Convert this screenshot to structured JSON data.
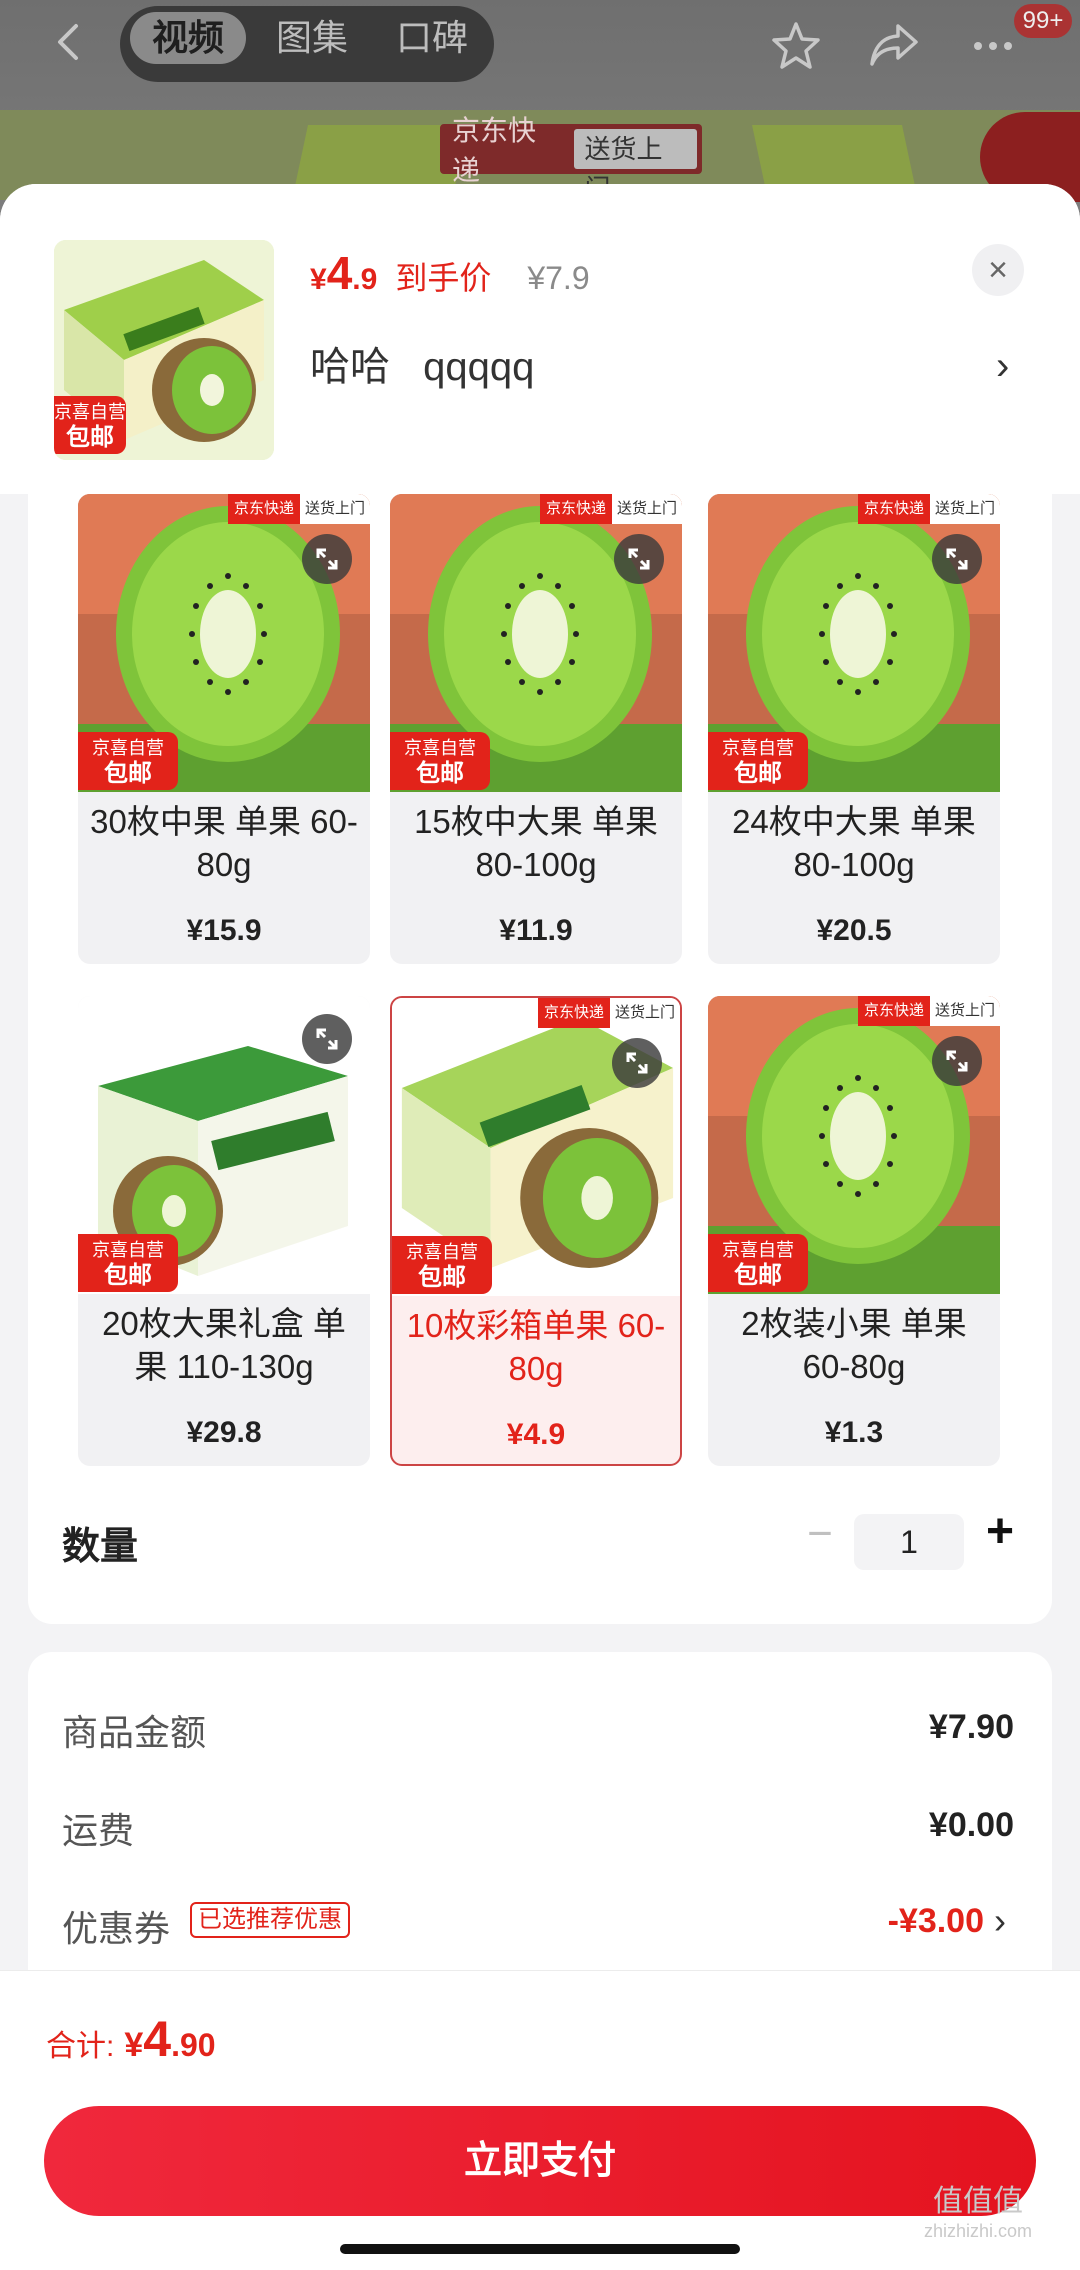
{
  "nav": {
    "tabs": [
      {
        "label": "视频",
        "active": true
      },
      {
        "label": "图集",
        "active": false
      },
      {
        "label": "口碑",
        "active": false
      }
    ],
    "badge": "99+",
    "banner": {
      "jd_label": "京东快递",
      "delivery_label": "送货上门"
    }
  },
  "sheet": {
    "price": {
      "currency": "¥",
      "integer": "4",
      "decimal": ".9",
      "tag": "到手价",
      "original": "¥7.9"
    },
    "spec_primary": "哈哈",
    "spec_secondary": "qqqqq",
    "thumb_badge": {
      "line1": "京喜自营",
      "line2": "包邮"
    },
    "close_label": "×"
  },
  "products": [
    {
      "name": "30枚中果 单果 60-80g",
      "price": "¥15.9",
      "jd_a": "京东快递",
      "jd_b": "送货上门",
      "tag1": "京喜自营",
      "tag2": "包邮",
      "image": "kiwi-slice",
      "selected": false
    },
    {
      "name": "15枚中大果 单果 80-100g",
      "price": "¥11.9",
      "jd_a": "京东快递",
      "jd_b": "送货上门",
      "tag1": "京喜自营",
      "tag2": "包邮",
      "image": "kiwi-slice",
      "selected": false
    },
    {
      "name": "24枚中大果 单果 80-100g",
      "price": "¥20.5",
      "jd_a": "京东快递",
      "jd_b": "送货上门",
      "tag1": "京喜自营",
      "tag2": "包邮",
      "image": "kiwi-slice",
      "selected": false
    },
    {
      "name": "20枚大果礼盒 单果 110-130g",
      "price": "¥29.8",
      "jd_a": "",
      "jd_b": "",
      "tag1": "京喜自营",
      "tag2": "包邮",
      "image": "gift-box",
      "selected": false
    },
    {
      "name": "10枚彩箱单果 60-80g",
      "price": "¥4.9",
      "jd_a": "京东快递",
      "jd_b": "送货上门",
      "tag1": "京喜自营",
      "tag2": "包邮",
      "image": "color-box",
      "selected": true
    },
    {
      "name": "2枚装小果  单果 60-80g",
      "price": "¥1.3",
      "jd_a": "京东快递",
      "jd_b": "送货上门",
      "tag1": "京喜自营",
      "tag2": "包邮",
      "image": "kiwi-slice",
      "selected": false
    }
  ],
  "quantity": {
    "label": "数量",
    "minus": "−",
    "value": "1",
    "plus": "+"
  },
  "fees": {
    "goods_label": "商品金额",
    "goods_value": "¥7.90",
    "shipping_label": "运费",
    "shipping_value": "¥0.00",
    "coupon_label": "优惠券",
    "coupon_chip": "已选推荐优惠",
    "coupon_value": "-¥3.00"
  },
  "footer": {
    "total_label": "合计:",
    "total_currency": "¥",
    "total_integer": "4",
    "total_decimal": ".90",
    "pay_label": "立即支付"
  },
  "watermark": {
    "line1": "值值值",
    "line2": "zhizhizhi.com"
  },
  "colors": {
    "accent": "#e2231a",
    "kiwi_green": "#8cc63f",
    "selected_bg": "#fdeeee"
  }
}
